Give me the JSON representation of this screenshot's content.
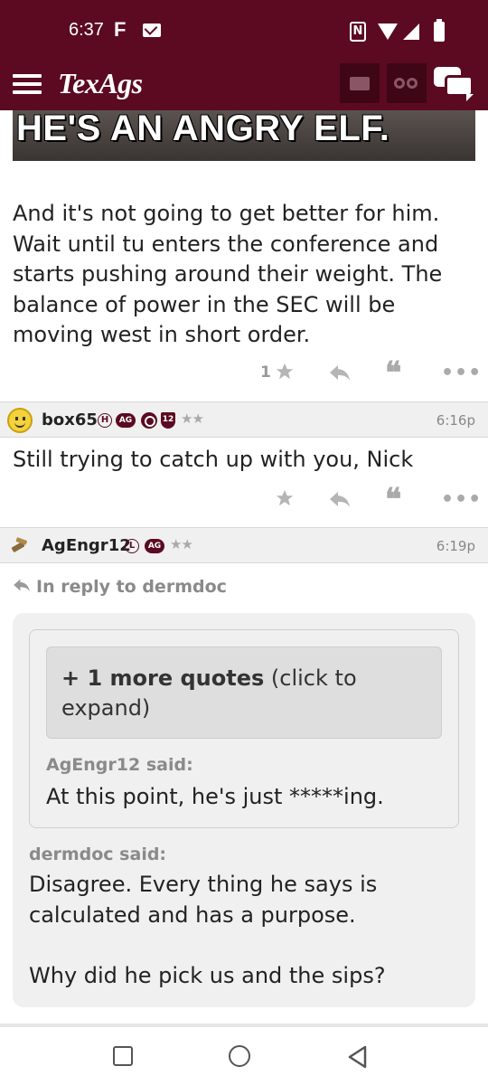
{
  "status_bar": {
    "time": "6:37",
    "notification_letter": "F",
    "nfc_label": "N"
  },
  "app_header": {
    "logo": "TexAgs",
    "icons": [
      "menu-icon",
      "mail-icon",
      "binoculars-icon",
      "chat-icon"
    ],
    "brand_color": "#5b0a22"
  },
  "post1": {
    "gif_caption": "HE'S AN ANGRY ELF.",
    "body": "And it's not going to get better for him. Wait until tu enters the conference and starts pushing around their weight. The balance of power in the SEC will be moving west in short order.",
    "star_count": "1"
  },
  "post2": {
    "username": "box65",
    "badges": [
      "H",
      "AG",
      "12"
    ],
    "rating": "★★",
    "time": "6:16p",
    "body": "Still trying to catch up with you, Nick"
  },
  "post3": {
    "username": "AgEngr12",
    "badges": [
      "L",
      "AG"
    ],
    "rating": "★★",
    "time": "6:19p",
    "in_reply_to": "In reply to dermdoc",
    "more_quotes_bold": "+ 1 more quotes",
    "more_quotes_rest": " (click to expand)",
    "inner_quote_author": "AgEngr12 said:",
    "inner_quote_text": "At this point, he's just *****ing.",
    "outer_quote_author": "dermdoc said:",
    "outer_quote_text_1": "Disagree. Every thing he says is calculated and has a purpose.",
    "outer_quote_text_2": "Why did he pick us and the sips?"
  },
  "nav_bar": {
    "buttons": [
      "recent-apps",
      "home",
      "back"
    ]
  }
}
